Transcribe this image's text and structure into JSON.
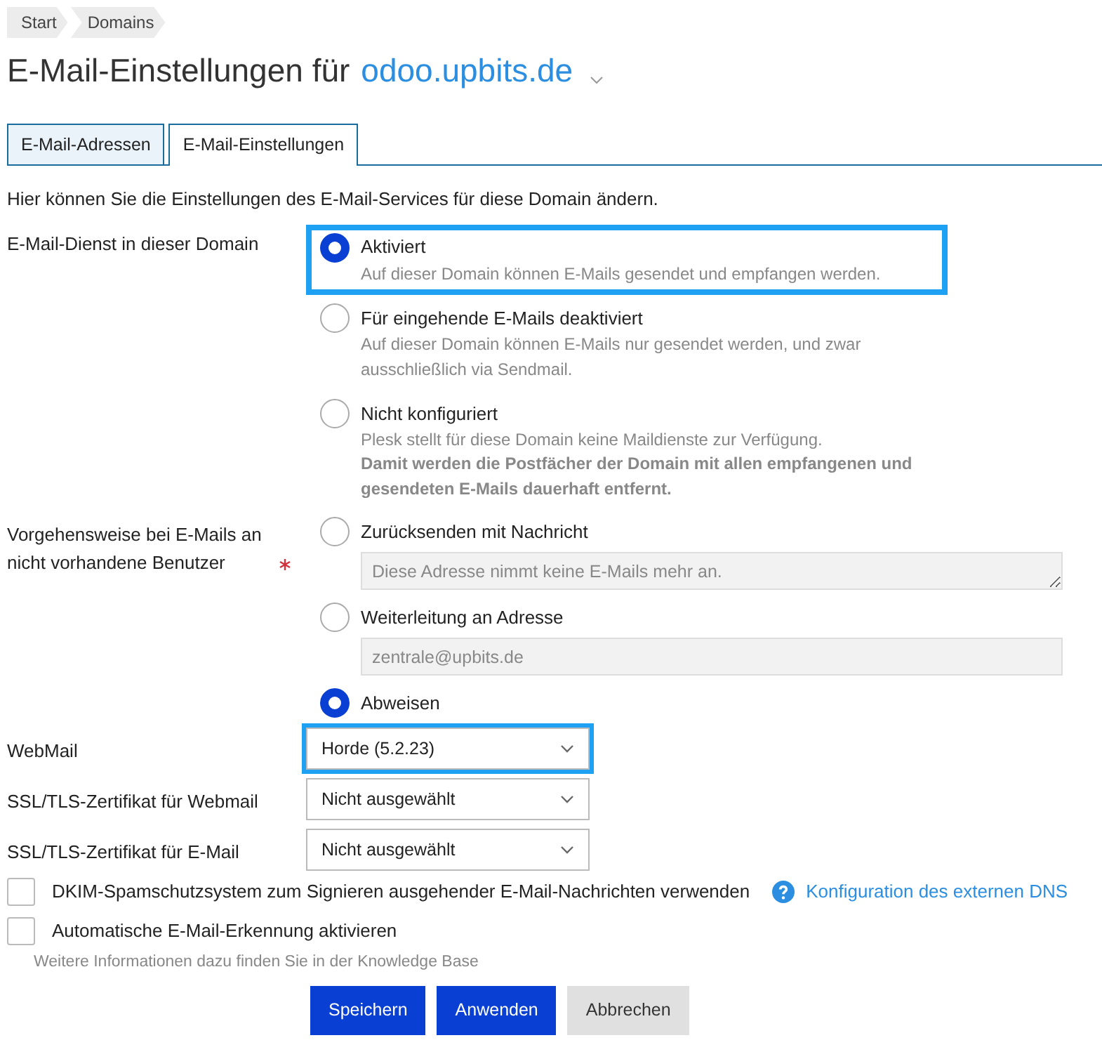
{
  "breadcrumbs": [
    {
      "label": "Start"
    },
    {
      "label": "Domains"
    }
  ],
  "title": {
    "text": "E-Mail-Einstellungen für",
    "domain": "odoo.upbits.de"
  },
  "tabs": [
    {
      "label": "E-Mail-Adressen",
      "selected": false
    },
    {
      "label": "E-Mail-Einstellungen",
      "selected": true
    }
  ],
  "intro": "Hier können Sie die Einstellungen des E-Mail-Services für diese Domain ändern.",
  "mail_service": {
    "label": "E-Mail-Dienst in dieser Domain",
    "options": [
      {
        "label": "Aktiviert",
        "selected": true,
        "highlighted": true,
        "description": "Auf dieser Domain können E-Mails gesendet und empfangen werden."
      },
      {
        "label": "Für eingehende E-Mails deaktiviert",
        "selected": false,
        "highlighted": false,
        "description": "Auf dieser Domain können E-Mails nur gesendet werden, und zwar ausschließlich via Sendmail."
      },
      {
        "label": "Nicht konfiguriert",
        "selected": false,
        "highlighted": false,
        "description": "Plesk stellt für diese Domain keine Maildienste zur Verfügung.",
        "warning": "Damit werden die Postfächer der Domain mit allen empfangenen und gesendeten E-Mails dauerhaft entfernt."
      }
    ]
  },
  "nonexistent_users": {
    "label": "Vorgehensweise bei E-Mails an nicht vorhandene Benutzer",
    "required": true,
    "options": [
      {
        "label": "Zurücksenden mit Nachricht",
        "selected": false,
        "field": {
          "kind": "textarea",
          "value": "Diese Adresse nimmt keine E-Mails mehr an.",
          "disabled": true
        }
      },
      {
        "label": "Weiterleitung an Adresse",
        "selected": false,
        "field": {
          "kind": "input",
          "value": "zentrale@upbits.de",
          "disabled": true
        }
      },
      {
        "label": "Abweisen",
        "selected": true
      }
    ]
  },
  "selects": [
    {
      "label": "WebMail",
      "value": "Horde (5.2.23)",
      "highlighted": true
    },
    {
      "label": "SSL/TLS-Zertifikat für Webmail",
      "value": "Nicht ausgewählt",
      "highlighted": false
    },
    {
      "label": "SSL/TLS-Zertifikat für E-Mail",
      "value": "Nicht ausgewählt",
      "highlighted": false
    }
  ],
  "checkboxes": [
    {
      "label": "DKIM-Spamschutzsystem zum Signieren ausgehender E-Mail-Nachrichten verwenden",
      "checked": false,
      "help_link": "Konfiguration des externen DNS"
    },
    {
      "label": "Automatische E-Mail-Erkennung aktivieren",
      "checked": false,
      "hint": "Weitere Informationen dazu finden Sie in der",
      "hint_link": "Knowledge Base"
    }
  ],
  "buttons": [
    {
      "label": "Speichern",
      "kind": "primary"
    },
    {
      "label": "Anwenden",
      "kind": "primary"
    },
    {
      "label": "Abbrechen",
      "kind": "secondary"
    }
  ]
}
